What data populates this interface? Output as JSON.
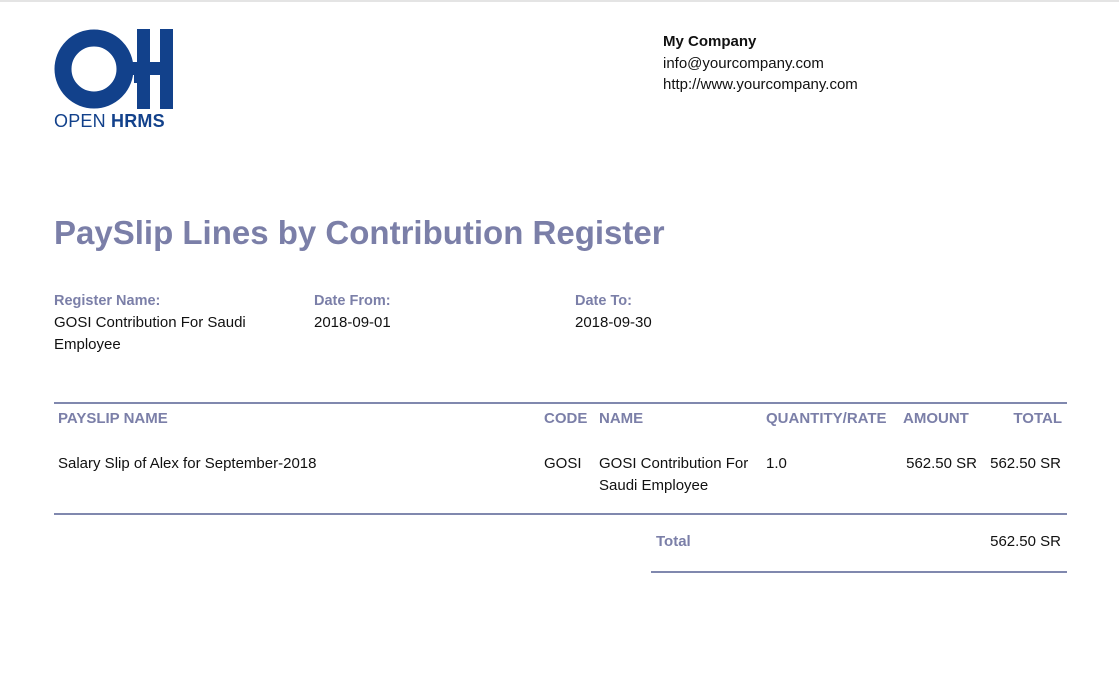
{
  "logo": {
    "icon": "open-hrms-logo",
    "brand_light": "OPEN",
    "brand_bold": "HRMS",
    "color": "#12418b"
  },
  "company": {
    "name": "My Company",
    "email": "info@yourcompany.com",
    "website": "http://www.yourcompany.com"
  },
  "report": {
    "title": "PaySlip Lines by Contribution Register",
    "accent_color": "#7b7fa8"
  },
  "info": {
    "register_name_label": "Register Name:",
    "register_name_line1": "GOSI Contribution For Saudi",
    "register_name_line2": "Employee",
    "date_from_label": "Date From:",
    "date_from": "2018-09-01",
    "date_to_label": "Date To:",
    "date_to": "2018-09-30"
  },
  "table": {
    "headers": {
      "payslip_name": "PAYSLIP NAME",
      "code": "CODE",
      "name": "NAME",
      "quantity_rate": "QUANTITY/RATE",
      "amount": "AMOUNT",
      "total": "TOTAL"
    },
    "rows": [
      {
        "payslip_name": "Salary Slip of Alex for September-2018",
        "code": "GOSI",
        "name_line1": "GOSI Contribution For",
        "name_line2": "Saudi Employee",
        "quantity_rate": "1.0",
        "amount": "562.50 SR",
        "total": "562.50 SR"
      }
    ]
  },
  "summary": {
    "total_label": "Total",
    "total_value": "562.50 SR"
  }
}
